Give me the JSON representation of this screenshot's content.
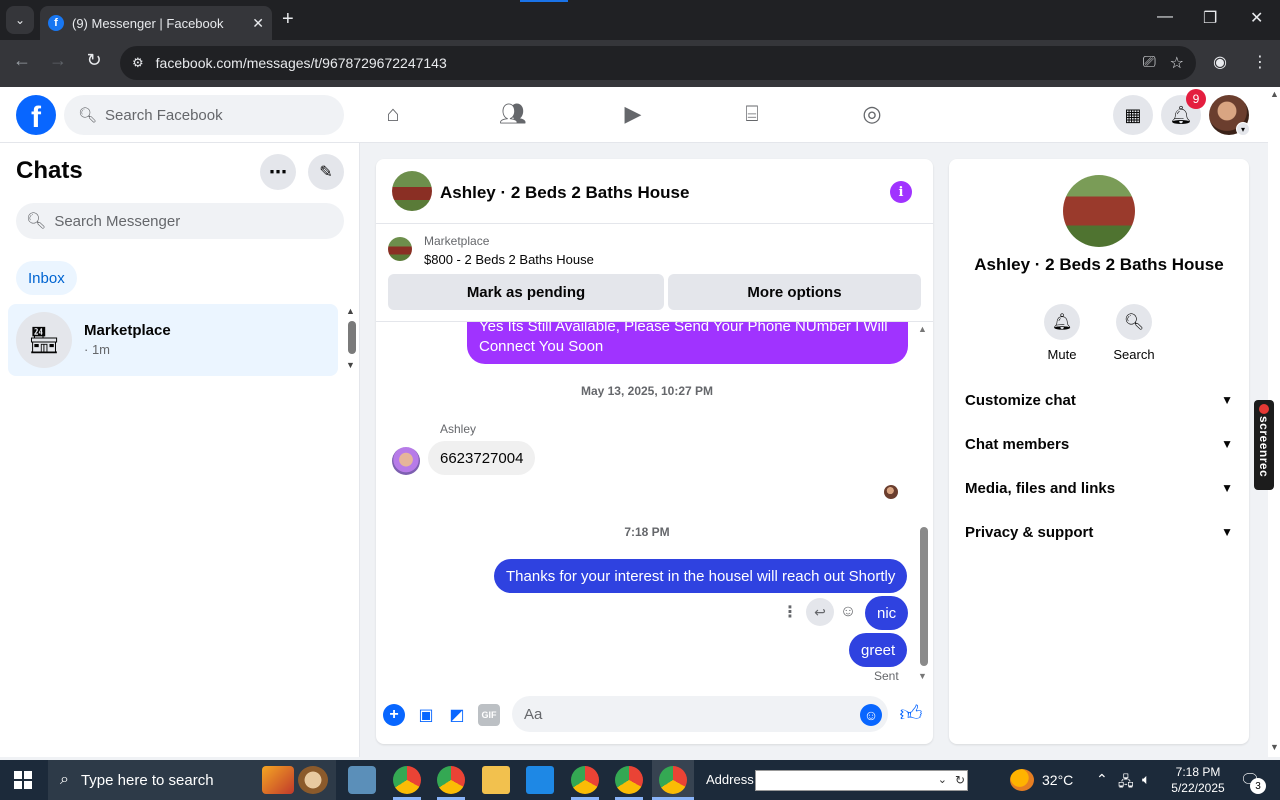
{
  "browser": {
    "tab_title": "(9) Messenger | Facebook",
    "url": "facebook.com/messages/t/9678729672247143"
  },
  "fb_header": {
    "search_placeholder": "Search Facebook",
    "notification_count": "9",
    "nav_icons": [
      "home-icon",
      "friends-icon",
      "video-icon",
      "marketplace-icon",
      "groups-icon"
    ]
  },
  "chats": {
    "title": "Chats",
    "search_placeholder": "Search Messenger",
    "filter": "Inbox",
    "items": [
      {
        "name": "Marketplace",
        "time": "· 1m"
      }
    ]
  },
  "conversation": {
    "name": "Ashley · 2 Beds 2 Baths House",
    "marketplace_label": "Marketplace",
    "listing": "$800 - 2 Beds 2 Baths House",
    "mark_pending": "Mark as pending",
    "more_options": "More options",
    "messages": {
      "out_top": "Yes Its Still Available, Please Send Your Phone NUmber I Will Connect You Soon",
      "date_sep": "May 13, 2025, 10:27 PM",
      "sender": "Ashley",
      "in_1": "6623727004",
      "time_sep": "7:18 PM",
      "out_1": "Thanks for your interest in the housel will reach out Shortly",
      "out_2": "nic",
      "out_3": "greet",
      "status": "Sent"
    },
    "composer_placeholder": "Aa"
  },
  "info_panel": {
    "name": "Ashley · 2 Beds 2 Baths House",
    "actions": [
      {
        "label": "Mute",
        "icon": "bell-icon"
      },
      {
        "label": "Search",
        "icon": "search-icon"
      }
    ],
    "sections": [
      "Customize chat",
      "Chat members",
      "Media, files and links",
      "Privacy & support"
    ]
  },
  "screenrec_label": "screenrec",
  "taskbar": {
    "search_placeholder": "Type here to search",
    "address_label": "Address",
    "temperature": "32°C",
    "time": "7:18 PM",
    "date": "5/22/2025",
    "notification_count": "3"
  },
  "colors": {
    "facebook_blue": "#0866ff",
    "outgoing_bubble": "#2f42e0",
    "accent_purple": "#a033ff"
  }
}
